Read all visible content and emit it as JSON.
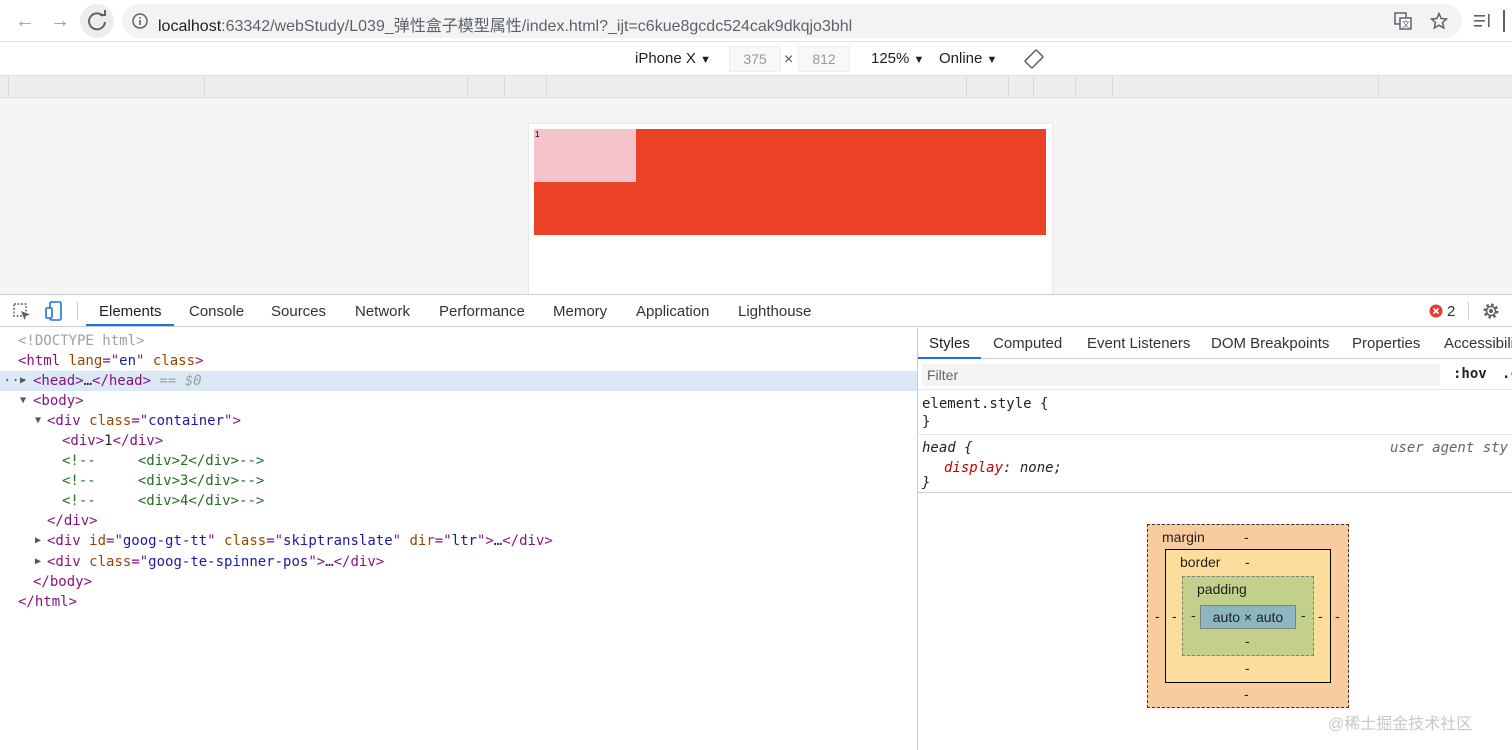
{
  "browser": {
    "url_host": "localhost",
    "url_rest": ":63342/webStudy/L039_弹性盒子模型属性/index.html?_ijt=c6kue8gcdc524cak9dkqjo3bhl"
  },
  "device_toolbar": {
    "device": "iPhone X",
    "width": "375",
    "height": "812",
    "times": "×",
    "zoom": "125%",
    "network": "Online"
  },
  "page": {
    "child_text": "1"
  },
  "devtools": {
    "tabs": [
      "Elements",
      "Console",
      "Sources",
      "Network",
      "Performance",
      "Memory",
      "Application",
      "Lighthouse"
    ],
    "error_count": "2",
    "styles_tabs": [
      "Styles",
      "Computed",
      "Event Listeners",
      "DOM Breakpoints",
      "Properties",
      "Accessibili"
    ],
    "filter_placeholder": "Filter",
    "hov": ":hov",
    "cls": ".c",
    "element_style": {
      "open": "element.style {",
      "close": "}"
    },
    "head_rule": {
      "selector": "head",
      "brace": " {",
      "source": "user agent sty",
      "prop": "display",
      "value": "none;",
      "close": "}"
    },
    "box_model": {
      "margin_label": "margin",
      "border_label": "border",
      "padding_label": "padding",
      "content": "auto × auto",
      "dash": "-"
    },
    "dom": {
      "doctype": "<!DOCTYPE html>",
      "selected_marker": "== $0",
      "ellipsis": "…",
      "container_class": "container",
      "child_text": "1",
      "comments": [
        "<div>2</div>",
        "<div>3</div>",
        "<div>4</div>"
      ],
      "goog_id": "goog-gt-tt",
      "goog_class": "skiptranslate",
      "goog_dir": "ltr",
      "spinner_class": "goog-te-spinner-pos",
      "html_lang": "en"
    }
  },
  "watermark": "@稀土掘金技术社区"
}
